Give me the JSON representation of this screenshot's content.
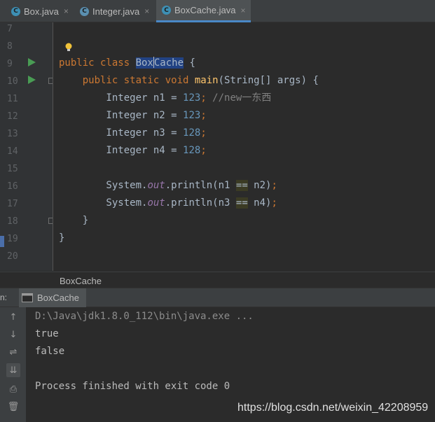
{
  "tabs": [
    {
      "label": "Box.java",
      "icon": "c-class-icon",
      "close": "×"
    },
    {
      "label": "Integer.java",
      "icon": "c-class-icon",
      "close": "×"
    },
    {
      "label": "BoxCache.java",
      "icon": "c-class-icon",
      "close": "×"
    }
  ],
  "editor": {
    "line_numbers": [
      "7",
      "8",
      "9",
      "10",
      "11",
      "12",
      "13",
      "14",
      "15",
      "16",
      "17",
      "18",
      "19",
      "20"
    ],
    "lines": {
      "l9_kw": "public class ",
      "l9_cls_a": "Box",
      "l9_cls_b": "Cache",
      "l9_rest": " {",
      "l10_kw": "    public static void ",
      "l10_fn": "main",
      "l10_rest": "(String[] args) {",
      "l11_a": "        Integer n1 = ",
      "l11_num": "123",
      "l11_semi": "; ",
      "l11_cmt": "//new一东西",
      "l12_a": "        Integer n2 = ",
      "l12_num": "123",
      "l12_semi": ";",
      "l13_a": "        Integer n3 = ",
      "l13_num": "128",
      "l13_semi": ";",
      "l14_a": "        Integer n4 = ",
      "l14_num": "128",
      "l14_semi": ";",
      "l16_a": "        System.",
      "l16_fld": "out",
      "l16_b": ".println(n1 ",
      "l16_op": "==",
      "l16_c": " n2)",
      "l16_semi": ";",
      "l17_a": "        System.",
      "l17_fld": "out",
      "l17_b": ".println(n3 ",
      "l17_op": "==",
      "l17_c": " n4)",
      "l17_semi": ";",
      "l18": "    }",
      "l19": "}"
    }
  },
  "breadcrumb": "BoxCache",
  "run": {
    "label": "n:",
    "tab": "BoxCache",
    "output": [
      "D:\\Java\\jdk1.8.0_112\\bin\\java.exe ...",
      "true",
      "false",
      "",
      "Process finished with exit code 0"
    ]
  },
  "watermark": "https://blog.csdn.net/weixin_42208959",
  "colors": {
    "keyword": "#cc7832",
    "number": "#6897bb",
    "comment": "#808080",
    "function": "#ffc66d",
    "field": "#9876aa",
    "run": "#499c54"
  }
}
